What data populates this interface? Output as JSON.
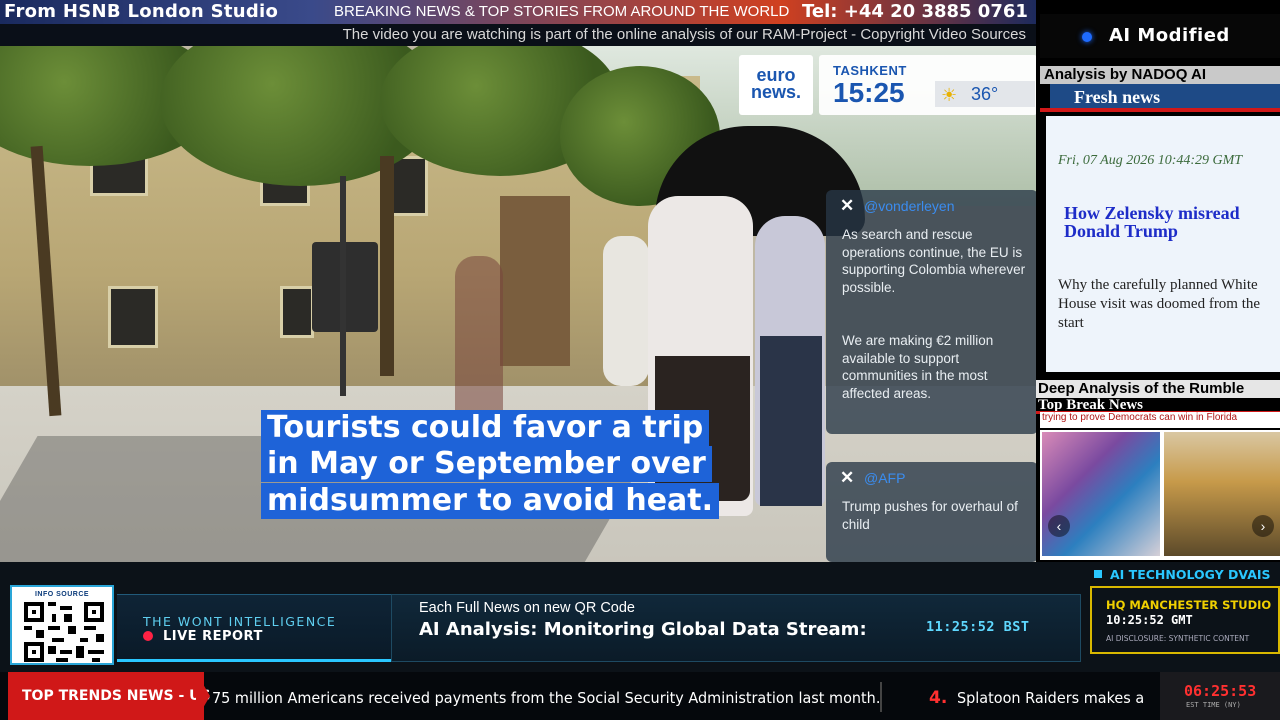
{
  "top_banner": {
    "studio": "From HSNB London Studio",
    "breaking": "BREAKING NEWS & TOP STORIES FROM AROUND THE WORLD",
    "tel": "Tel: +44 20 3885 0761",
    "subline": "The video you are watching is part of the online analysis of our RAM-Project - Copyright Video Sources"
  },
  "video": {
    "euronews_logo": "euro\nnews.",
    "city": "TASHKENT",
    "time": "15:25",
    "temperature": "36°",
    "caption_lines": [
      "Tourists could favor a trip",
      "in May or September over",
      "midsummer to avoid heat."
    ],
    "tweet1": {
      "handle": "@vonderleyen",
      "p1": "As search and rescue operations continue, the EU is supporting Colombia wherever possible.",
      "p2": "We are making €2 million available to support communities in the most affected areas."
    },
    "tweet2": {
      "handle": "@AFP",
      "body": "Trump pushes for overhaul of child"
    }
  },
  "right_panel": {
    "ai_modified": "AI Modified",
    "analysis_by": "Analysis by NADOQ AI",
    "fresh_news": "Fresh news",
    "date": "Fri, 07 Aug 2026 10:44:29 GMT",
    "headline": "How Zelensky misread Donald Trump",
    "description": "Why the carefully planned White House visit was doomed from the start",
    "deep_analysis": "Deep Analysis of the Rumble",
    "top_break": "Top Break News",
    "trying": "trying to prove Democrats can win in Florida"
  },
  "bottom": {
    "info_source": "INFO SOURCE",
    "wont_title": "THE WONT INTELLIGENCE",
    "live_report": "LIVE REPORT",
    "each_full": "Each Full News on new QR Code",
    "analysis_headline": "AI Analysis: Monitoring Global Data Stream:",
    "panel_clock": "11:25:52 BST",
    "ai_tech": "AI TECHNOLOGY DVAIS",
    "hq_studio": "HQ MANCHESTER STUDIO",
    "hq_time": "10:25:52 GMT",
    "ai_disclosure": "AI DISCLOSURE: SYNTHETIC CONTENT"
  },
  "ticker": {
    "label": "TOP TRENDS NEWS - US",
    "item1": "75 million Americans received payments from the Social Security Administration last month.",
    "number": "4.",
    "item2": "Splatoon Raiders makes a splash",
    "clock": "06:25:53",
    "clock_zone": "EST TIME (NY)"
  },
  "colors": {
    "caption_blue": "#1e63d8",
    "accent_cyan": "#2ac7ff",
    "ticker_red": "#d01818",
    "hq_yellow": "#d9b800"
  },
  "icons": [
    "x-icon",
    "sun-cloud-icon",
    "qr-code-icon",
    "chevron-left-icon",
    "chevron-right-icon",
    "live-dot-icon"
  ]
}
